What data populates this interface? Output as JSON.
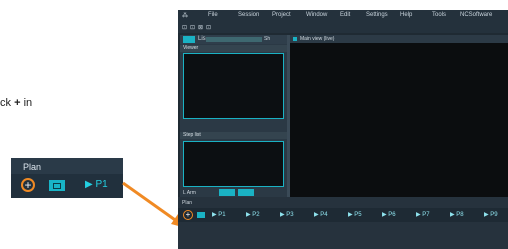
{
  "instruction": {
    "before": "ck",
    "symbol": "+",
    "after": "in"
  },
  "callout": {
    "title": "Plan",
    "add_symbol": "+",
    "step_label": "▶ P1"
  },
  "app": {
    "menu": [
      "⁂",
      "File",
      "Session",
      "Project",
      "Window",
      "Edit",
      "Settings",
      "Help",
      "Tools",
      "NCSoftware"
    ],
    "toolbar_icons": [
      "⊡",
      "⊡",
      "⊠",
      "⊡"
    ],
    "left_tab": {
      "second": "Lis",
      "right": "Sh"
    },
    "panel1_title": "Viewer",
    "panel2_title": "Step list",
    "left_buttons": {
      "a": "L Arm"
    },
    "main_tab_title": "Main view (live)",
    "plan_label": "Plan",
    "steps": [
      "▶ P1",
      "▶ P2",
      "▶ P3",
      "▶ P4",
      "▶ P5",
      "▶ P6",
      "▶ P7",
      "▶ P8",
      "▶ P9"
    ],
    "step_add_symbol": "+"
  },
  "colors": {
    "accent": "#1ab2c4",
    "highlight": "#f08a24",
    "panel": "#1f2a33"
  }
}
